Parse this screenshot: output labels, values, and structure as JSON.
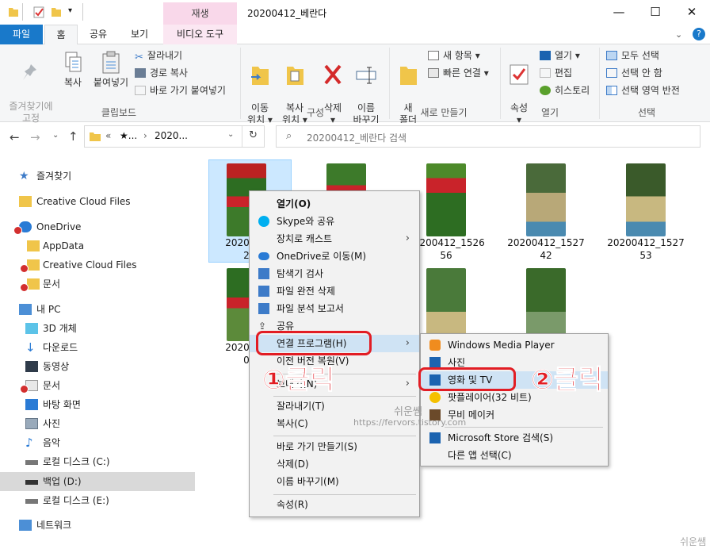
{
  "window": {
    "title": "20200412_베란다",
    "context_tab_group": "재생",
    "controls": {
      "minimize": "—",
      "maximize": "☐",
      "close": "✕"
    }
  },
  "ribbon_tabs": [
    "파일",
    "홈",
    "공유",
    "보기",
    "비디오 도구"
  ],
  "ribbon": {
    "clipboard": {
      "pin": "즐겨찾기에\n고정",
      "copy": "복사",
      "paste": "붙여넣기",
      "cut": "잘라내기",
      "copy_path": "경로 복사",
      "paste_shortcut": "바로 가기 붙여넣기",
      "label": "클립보드"
    },
    "organize": {
      "move_to": "이동\n위치 ▾",
      "copy_to": "복사\n위치 ▾",
      "delete": "삭제\n▾",
      "rename": "이름\n바꾸기",
      "label": "구성"
    },
    "new": {
      "new_folder": "새\n폴더",
      "new_item": "새 항목 ▾",
      "easy_access": "빠른 연결 ▾",
      "label": "새로 만들기"
    },
    "open": {
      "properties": "속성\n▾",
      "open": "열기 ▾",
      "edit": "편집",
      "history": "히스토리",
      "label": "열기"
    },
    "select": {
      "select_all": "모두 선택",
      "select_none": "선택 안 함",
      "invert": "선택 영역 반전",
      "label": "선택"
    }
  },
  "address": {
    "path_prefix": "«",
    "path_star": "★...",
    "path_current": "2020...",
    "search_placeholder": "20200412_베란다 검색"
  },
  "nav_pane": [
    {
      "label": "즐겨찾기",
      "icon": "star-icon"
    },
    {
      "label": "Creative Cloud Files",
      "icon": "cc-folder-icon"
    },
    {
      "label": "OneDrive",
      "icon": "cloud-icon"
    },
    {
      "label": "AppData",
      "icon": "folder-icon"
    },
    {
      "label": "Creative Cloud Files",
      "icon": "folder-icon"
    },
    {
      "label": "문서",
      "icon": "document-icon"
    },
    {
      "label": "내 PC",
      "icon": "pc-icon"
    },
    {
      "label": "3D 개체",
      "icon": "cube-icon"
    },
    {
      "label": "다운로드",
      "icon": "download-icon"
    },
    {
      "label": "동영상",
      "icon": "video-icon"
    },
    {
      "label": "문서",
      "icon": "document-icon"
    },
    {
      "label": "바탕 화면",
      "icon": "desktop-icon"
    },
    {
      "label": "사진",
      "icon": "pictures-icon"
    },
    {
      "label": "음악",
      "icon": "music-icon"
    },
    {
      "label": "로컬 디스크 (C:)",
      "icon": "drive-icon"
    },
    {
      "label": "백업 (D:)",
      "icon": "drive-icon"
    },
    {
      "label": "로컬 디스크 (E:)",
      "icon": "drive-icon"
    },
    {
      "label": "네트워크",
      "icon": "network-icon"
    }
  ],
  "files": [
    {
      "name_line1": "2020041",
      "name_line2": "2"
    },
    {
      "name_line1": "",
      "name_line2": ""
    },
    {
      "name_line1": "20200412_1526",
      "name_line2": "56"
    },
    {
      "name_line1": "20200412_1527",
      "name_line2": "42"
    },
    {
      "name_line1": "20200412_1527",
      "name_line2": "53"
    },
    {
      "name_line1": "2020041",
      "name_line2": "0"
    }
  ],
  "context_menu": {
    "items": [
      "열기(O)",
      "Skype와 공유",
      "장치로 캐스트",
      "OneDrive로 이동(M)",
      "탐색기 검사",
      "파일 완전 삭제",
      "파일 분석 보고서",
      "공유",
      "연결 프로그램(H)",
      "이전 버전 복원(V)",
      "보내기(N)",
      "잘라내기(T)",
      "복사(C)",
      "바로 가기 만들기(S)",
      "삭제(D)",
      "이름 바꾸기(M)",
      "속성(R)"
    ]
  },
  "submenu": {
    "items": [
      "Windows Media Player",
      "사진",
      "영화 및 TV",
      "팟플레이어(32 비트)",
      "무비 메이커",
      "Microsoft Store 검색(S)",
      "다른 앱 선택(C)"
    ]
  },
  "annotations": {
    "step1": "①클릭",
    "step2": "②클릭",
    "watermark_name": "쉬운쌤",
    "watermark_url": "https://fervors.tistory.com",
    "corner_mark": "쉬운쌤"
  },
  "colors": {
    "accent": "#1979ca",
    "highlight": "#cfe3f4",
    "callout": "#e21d24",
    "video_tab": "#f9d8ea"
  }
}
